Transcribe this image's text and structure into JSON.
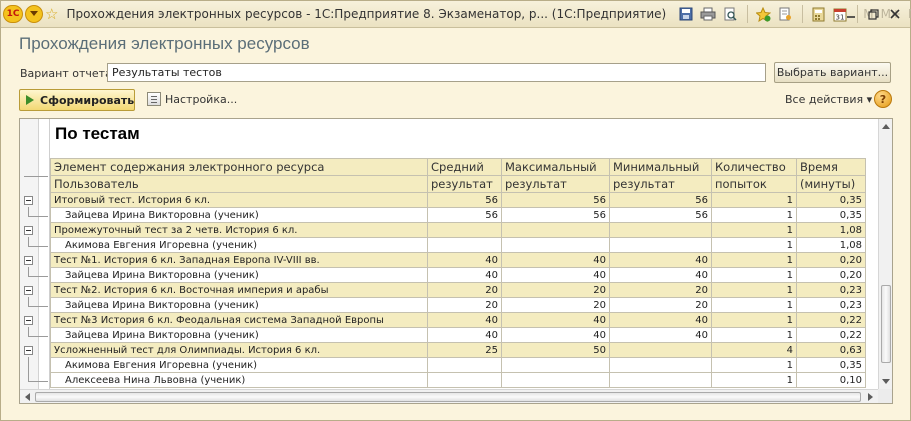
{
  "window": {
    "title": "Прохождения электронных ресурсов - 1С:Предприятие 8. Экзаменатор, р...  (1С:Предприятие)",
    "memory_buttons": [
      "M",
      "M+",
      "M-"
    ],
    "logo_text": "1С"
  },
  "form": {
    "title": "Прохождения электронных ресурсов",
    "variant_label": "Вариант отчета:",
    "variant_value": "Результаты тестов",
    "choose_variant_label": "Выбрать вариант...",
    "generate_label": "Сформировать",
    "settings_label": "Настройка...",
    "all_actions_label": "Все действия ▾",
    "help_label": "?"
  },
  "report": {
    "heading": "По тестам",
    "header_top": [
      "Элемент содержания электронного ресурса",
      "Средний",
      "Максимальный",
      "Минимальный",
      "Количество",
      "Время"
    ],
    "header_bottom": [
      "Пользователь",
      "результат",
      "результат",
      "результат",
      "попыток",
      "(минуты)"
    ],
    "rows": [
      {
        "type": "group",
        "name": "Итоговый тест. История 6 кл.",
        "avg": "56",
        "max": "56",
        "min": "56",
        "count": "1",
        "time": "0,35"
      },
      {
        "type": "detail",
        "name": "Зайцева Ирина Викторовна (ученик)",
        "avg": "56",
        "max": "56",
        "min": "56",
        "count": "1",
        "time": "0,35"
      },
      {
        "type": "group",
        "name": "Промежуточный тест за 2 четв. История 6 кл.",
        "avg": "",
        "max": "",
        "min": "",
        "count": "1",
        "time": "1,08"
      },
      {
        "type": "detail",
        "name": "Акимова Евгения Игоревна (ученик)",
        "avg": "",
        "max": "",
        "min": "",
        "count": "1",
        "time": "1,08"
      },
      {
        "type": "group",
        "name": "Тест №1.  История 6 кл. Западная Европа IV-VIII вв.",
        "avg": "40",
        "max": "40",
        "min": "40",
        "count": "1",
        "time": "0,20"
      },
      {
        "type": "detail",
        "name": "Зайцева Ирина Викторовна (ученик)",
        "avg": "40",
        "max": "40",
        "min": "40",
        "count": "1",
        "time": "0,20"
      },
      {
        "type": "group",
        "name": "Тест №2.  История 6 кл. Восточная империя и арабы",
        "avg": "20",
        "max": "20",
        "min": "20",
        "count": "1",
        "time": "0,23"
      },
      {
        "type": "detail",
        "name": "Зайцева Ирина Викторовна (ученик)",
        "avg": "20",
        "max": "20",
        "min": "20",
        "count": "1",
        "time": "0,23"
      },
      {
        "type": "group",
        "name": "Тест №3  История 6 кл. Феодальная система Западной Европы",
        "avg": "40",
        "max": "40",
        "min": "40",
        "count": "1",
        "time": "0,22"
      },
      {
        "type": "detail",
        "name": "Зайцева Ирина Викторовна (ученик)",
        "avg": "40",
        "max": "40",
        "min": "40",
        "count": "1",
        "time": "0,22"
      },
      {
        "type": "group",
        "name": "Усложненный тест для Олимпиады. История 6 кл.",
        "avg": "25",
        "max": "50",
        "min": "",
        "count": "4",
        "time": "0,63"
      },
      {
        "type": "detail",
        "name": "Акимова Евгения Игоревна (ученик)",
        "avg": "",
        "max": "",
        "min": "",
        "count": "1",
        "time": "0,35"
      },
      {
        "type": "detail",
        "name": "Алексеева Нина Львовна (ученик)",
        "avg": "",
        "max": "",
        "min": "",
        "count": "1",
        "time": "0,10"
      }
    ]
  },
  "colors": {
    "background": "#fbf4dd",
    "header_fill": "#f4ecc0",
    "title_color": "#5b6e78",
    "generate_button": "#f2d874"
  }
}
